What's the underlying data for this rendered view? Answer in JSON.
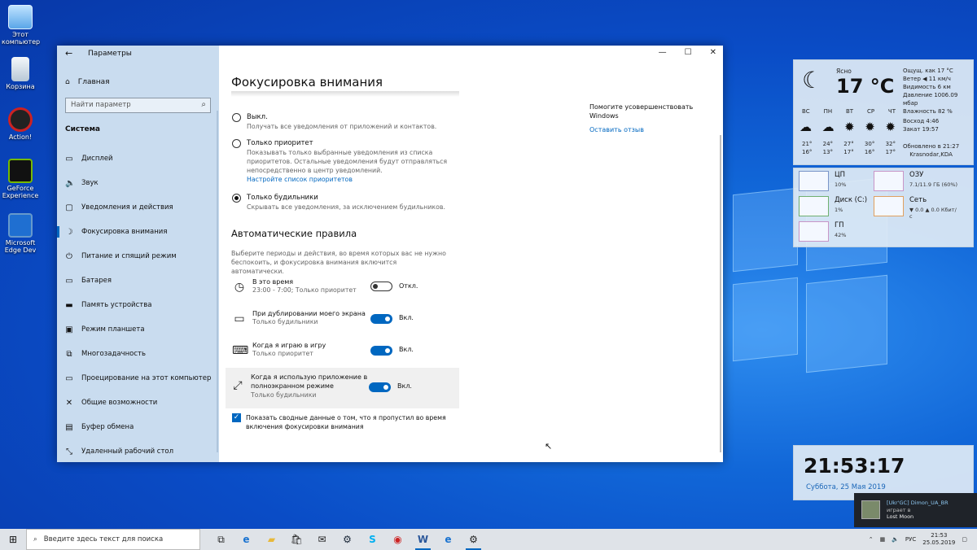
{
  "desktop": {
    "icons": [
      {
        "label": "Этот компьютер",
        "icon": "computer-icon"
      },
      {
        "label": "Корзина",
        "icon": "recycle-bin-icon"
      },
      {
        "label": "Action!",
        "icon": "action-app-icon"
      },
      {
        "label": "GeForce Experience",
        "icon": "geforce-icon"
      },
      {
        "label": "Microsoft Edge Dev",
        "icon": "edge-dev-icon"
      }
    ]
  },
  "window": {
    "title": "Параметры",
    "controls": {
      "minimize": "—",
      "maximize": "☐",
      "close": "✕"
    }
  },
  "sidebar": {
    "home_label": "Главная",
    "search_placeholder": "Найти параметр",
    "section_title": "Система",
    "items": [
      {
        "label": "Дисплей",
        "icon": "display-icon",
        "glyph": "▭"
      },
      {
        "label": "Звук",
        "icon": "sound-icon",
        "glyph": "🔈"
      },
      {
        "label": "Уведомления и действия",
        "icon": "notifications-icon",
        "glyph": "▢"
      },
      {
        "label": "Фокусировка внимания",
        "icon": "focus-assist-icon",
        "glyph": "☽",
        "active": true
      },
      {
        "label": "Питание и спящий режим",
        "icon": "power-icon",
        "glyph": "⏻"
      },
      {
        "label": "Батарея",
        "icon": "battery-icon",
        "glyph": "▭"
      },
      {
        "label": "Память устройства",
        "icon": "storage-icon",
        "glyph": "▬"
      },
      {
        "label": "Режим планшета",
        "icon": "tablet-mode-icon",
        "glyph": "▣"
      },
      {
        "label": "Многозадачность",
        "icon": "multitasking-icon",
        "glyph": "⧉"
      },
      {
        "label": "Проецирование на этот компьютер",
        "icon": "projecting-icon",
        "glyph": "▭"
      },
      {
        "label": "Общие возможности",
        "icon": "shared-experiences-icon",
        "glyph": "✕"
      },
      {
        "label": "Буфер обмена",
        "icon": "clipboard-icon",
        "glyph": "▤"
      },
      {
        "label": "Удаленный рабочий стол",
        "icon": "remote-desktop-icon",
        "glyph": "⤡"
      }
    ]
  },
  "main": {
    "title": "Фокусировка внимания",
    "options": [
      {
        "label": "Выкл.",
        "desc": "Получать все уведомления от приложений и контактов.",
        "selected": false
      },
      {
        "label": "Только приоритет",
        "desc": "Показывать только выбранные уведомления из списка приоритетов. Остальные уведомления будут отправляться непосредственно в центр уведомлений.",
        "link": "Настройте список приоритетов",
        "selected": false
      },
      {
        "label": "Только будильники",
        "desc": "Скрывать все уведомления, за исключением будильников.",
        "selected": true
      }
    ],
    "auto_rules_title": "Автоматические правила",
    "auto_rules_desc": "Выберите периоды и действия, во время которых вас не нужно беспокоить, и фокусировка внимания включится автоматически.",
    "rules": [
      {
        "name": "В это время",
        "sub": "23:00 - 7:00; Только приоритет",
        "state": "Откл.",
        "on": false,
        "icon": "clock-icon"
      },
      {
        "name": "При дублировании моего экрана",
        "sub": "Только будильники",
        "state": "Вкл.",
        "on": true,
        "icon": "monitor-icon"
      },
      {
        "name": "Когда я играю в игру",
        "sub": "Только приоритет",
        "state": "Вкл.",
        "on": true,
        "icon": "gamepad-icon"
      },
      {
        "name": "Когда я использую приложение в полноэкранном режиме",
        "sub": "Только будильники",
        "state": "Вкл.",
        "on": true,
        "icon": "fullscreen-icon"
      }
    ],
    "summary_checkbox": "Показать сводные данные о том, что я пропустил во время включения фокусировки внимания",
    "help_text": "Помогите усовершенствовать Windows",
    "feedback_link": "Оставить отзыв"
  },
  "weather": {
    "condition": "Ясно",
    "temp": "17 °C",
    "stats": [
      "Ощущ. как 17 °C",
      "Ветер  ◀ 11 км/ч",
      "Видимость 6 км",
      "Давление 1006.09 мбар",
      "Влажность 82 %"
    ],
    "days": [
      "ВС",
      "ПН",
      "ВТ",
      "СР",
      "ЧТ"
    ],
    "day_icons": [
      "cloud-rain-icon",
      "cloud-rain-icon",
      "sun-icon",
      "sun-icon",
      "sun-icon"
    ],
    "highs": [
      "21°",
      "24°",
      "27°",
      "30°",
      "32°"
    ],
    "lows": [
      "16°",
      "13°",
      "17°",
      "16°",
      "17°"
    ],
    "sunrise": "Восход  4:46",
    "sunset": "Закат  19:57",
    "updated": "Обновлено в 21:27",
    "location": "Krasnodar,KDA"
  },
  "sysmon": [
    {
      "name": "ЦП",
      "value": "10%",
      "color": "#7a95c8"
    },
    {
      "name": "ОЗУ",
      "value": "7.1/11.9 ГБ (60%)",
      "color": "#c896c8"
    },
    {
      "name": "Диск (C:)",
      "value": "1%",
      "color": "#70b070"
    },
    {
      "name": "Сеть",
      "value": "▼ 0.0  ▲ 0.0 Кбит/с",
      "color": "#e0a060"
    },
    {
      "name": "ГП",
      "value": "42%",
      "color": "#c896c8"
    }
  ],
  "clock": {
    "time": "21:53:17",
    "date": "Суббота, 25 Мая 2019"
  },
  "notification": {
    "user": "[Ukr'GC] Dimon_UA_BR",
    "action": "играет в",
    "game": "Lost Moon"
  },
  "taskbar": {
    "search_placeholder": "Введите здесь текст для поиска",
    "apps": [
      "task-view-icon",
      "edge-icon",
      "explorer-icon",
      "store-icon",
      "mail-icon",
      "steam-icon",
      "skype-icon",
      "action-icon",
      "word-icon",
      "edge-dev-icon",
      "settings-icon"
    ],
    "lang": "РУС",
    "time": "21:53",
    "date": "25.05.2019"
  }
}
